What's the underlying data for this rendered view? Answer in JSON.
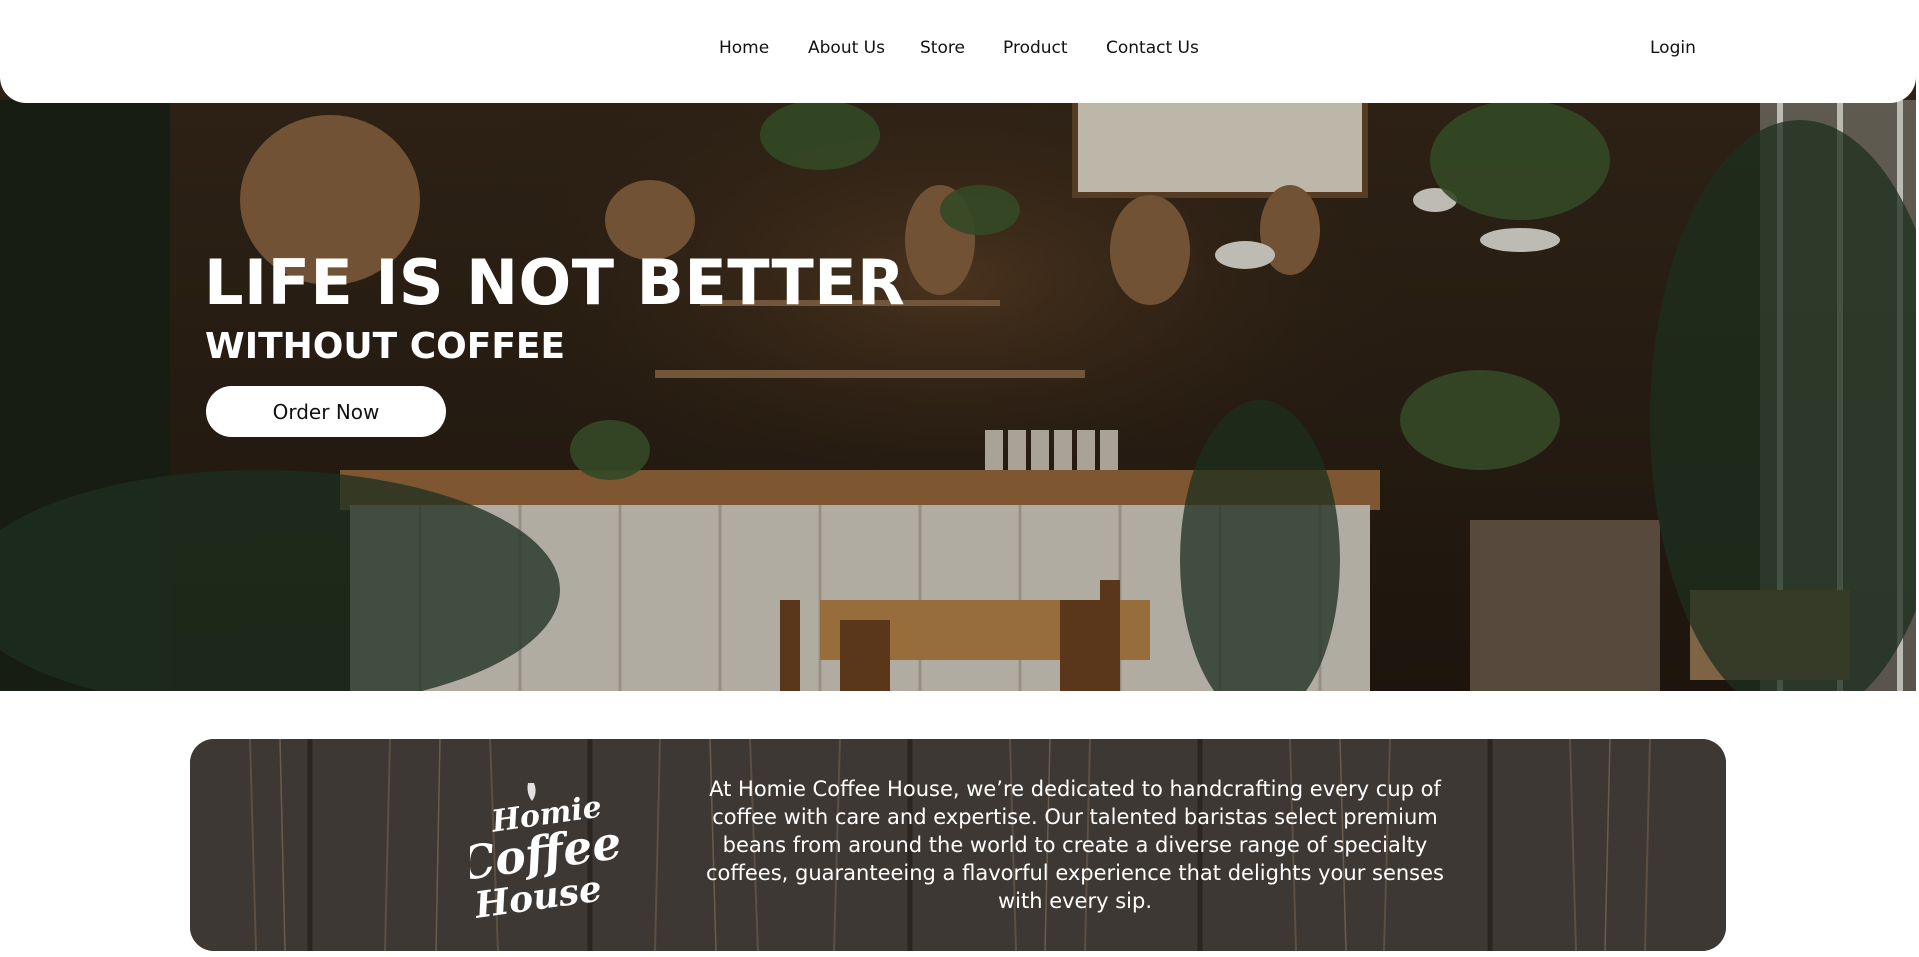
{
  "header": {
    "nav": [
      {
        "label": "Home"
      },
      {
        "label": "About Us"
      },
      {
        "label": "Store"
      },
      {
        "label": "Product"
      },
      {
        "label": "Contact Us"
      }
    ],
    "login_label": "Login"
  },
  "hero": {
    "title": "LIFE IS NOT BETTER",
    "subtitle": "WITHOUT COFFEE",
    "cta_label": "Order Now",
    "background_image": "cafe-interior-photo"
  },
  "about": {
    "logo_text": [
      "Homie",
      "Coffee",
      "House"
    ],
    "description": "At Homie Coffee House, we’re dedicated to handcrafting every cup of coffee with care and expertise. Our talented baristas select premium beans from around the world to create a diverse range of specialty coffees, guaranteeing a flavorful experience that delights your senses with every sip.",
    "background_image": "dark-wood-texture"
  },
  "colors": {
    "header_bg": "#ffffff",
    "text_dark": "#111111",
    "hero_text": "#ffffff",
    "wood_dark": "#3a3530"
  }
}
